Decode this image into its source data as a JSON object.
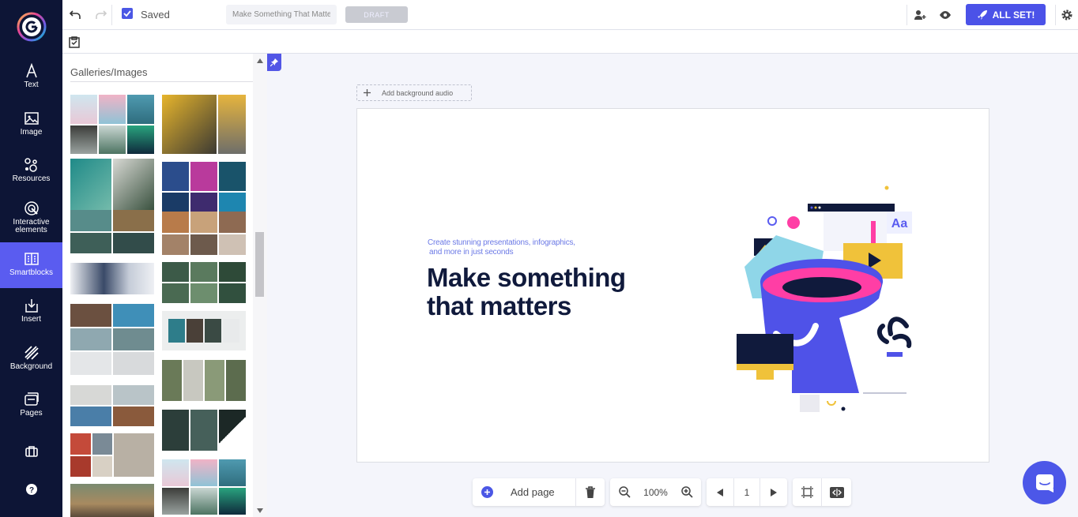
{
  "brand": {
    "accent": "#5a5cf0",
    "rail_bg": "#0d1536"
  },
  "rail": {
    "items": [
      {
        "label": "Text",
        "icon": "text-icon"
      },
      {
        "label": "Image",
        "icon": "image-icon"
      },
      {
        "label": "Resources",
        "icon": "resources-icon"
      },
      {
        "label": "Interactive elements",
        "icon": "interactive-icon"
      },
      {
        "label": "Smartblocks",
        "icon": "smartblocks-icon",
        "active": true
      },
      {
        "label": "Insert",
        "icon": "insert-icon"
      },
      {
        "label": "Background",
        "icon": "background-icon"
      },
      {
        "label": "Pages",
        "icon": "pages-icon"
      }
    ]
  },
  "topbar": {
    "saved_label": "Saved",
    "project_title": "Make Something That Matters",
    "draft_label": "DRAFT",
    "allset_label": "ALL SET!"
  },
  "panel": {
    "title": "Galleries/Images"
  },
  "canvas": {
    "audio_label": "Add background audio",
    "subtitle_line1": "Create stunning presentations, infographics,",
    "subtitle_line2": "and more in just seconds",
    "headline_line1": "Make something",
    "headline_line2": "that matters",
    "illustration_label": "Aa"
  },
  "bottombar": {
    "add_page_label": "Add page",
    "zoom_value": "100%",
    "page_number": "1"
  }
}
